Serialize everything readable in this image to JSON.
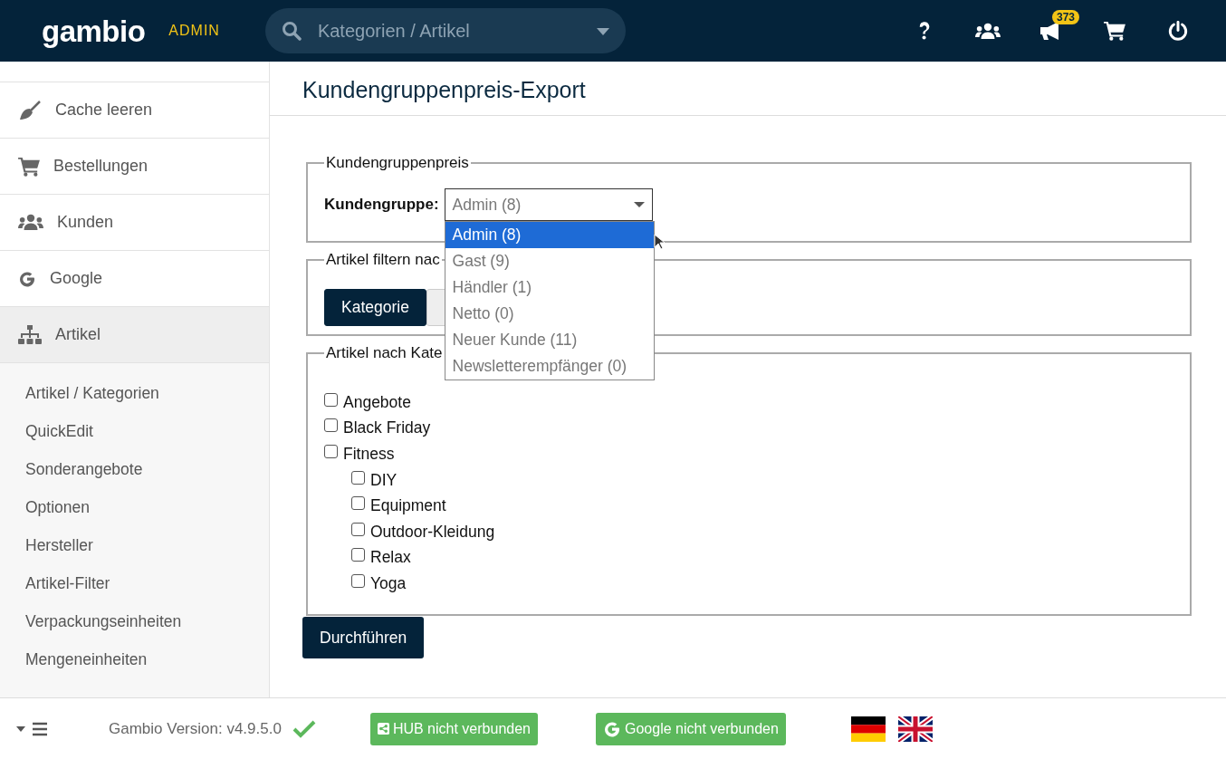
{
  "header": {
    "logo": "gambio",
    "tag": "ADMIN",
    "search": {
      "placeholder": "Kategorien / Artikel"
    },
    "icons": [
      {
        "kind": "help"
      },
      {
        "kind": "users"
      },
      {
        "kind": "bullhorn",
        "count": "373"
      },
      {
        "kind": "cart"
      },
      {
        "kind": "power"
      }
    ]
  },
  "sidebar": {
    "items": [
      {
        "label": "Cache leeren",
        "kind": "broom",
        "selected": false
      },
      {
        "label": "Bestellungen",
        "kind": "cart",
        "selected": false
      },
      {
        "label": "Kunden",
        "kind": "users",
        "selected": false
      },
      {
        "label": "Google",
        "kind": "google",
        "selected": false
      },
      {
        "label": "Artikel",
        "kind": "sitemap",
        "selected": true
      }
    ],
    "subitems": [
      "Artikel / Kategorien",
      "QuickEdit",
      "Sonderangebote",
      "Optionen",
      "Hersteller",
      "Artikel-Filter",
      "Verpackungseinheiten",
      "Mengeneinheiten"
    ]
  },
  "page": {
    "title": "Kundengruppenpreis-Export",
    "group_fieldset": {
      "legend": "Kundengruppenpreis",
      "label": "Kundengruppe:",
      "value": "Admin (8)",
      "expanded": true,
      "options": [
        {
          "label": "Admin (8)",
          "selected": true
        },
        {
          "label": "Gast (9)",
          "selected": false
        },
        {
          "label": "Händler (1)",
          "selected": false
        },
        {
          "label": "Netto (0)",
          "selected": false
        },
        {
          "label": "Neuer Kunde (11)",
          "selected": false
        },
        {
          "label": "Newsletterempfänger (0)",
          "selected": false
        }
      ]
    },
    "filter_fieldset": {
      "legend": "Artikel filtern nac",
      "buttons": [
        {
          "label": "Kategorie",
          "selected": true
        },
        {
          "selected": false
        }
      ]
    },
    "category_fieldset": {
      "legend": "Artikel nach Kate",
      "categories": [
        {
          "label": "Angebote",
          "checked": false
        },
        {
          "label": "Black Friday",
          "checked": false
        },
        {
          "label": "Fitness",
          "checked": false,
          "children": [
            {
              "label": "DIY",
              "checked": false
            },
            {
              "label": "Equipment",
              "checked": false
            },
            {
              "label": "Outdoor-Kleidung",
              "checked": false
            },
            {
              "label": "Relax",
              "checked": false
            },
            {
              "label": "Yoga",
              "checked": false
            }
          ]
        }
      ]
    },
    "submit": "Durchführen"
  },
  "footer": {
    "version": "Gambio Version: v4.9.5.0",
    "version_ok": true,
    "status_buttons": [
      {
        "kind": "hub",
        "label": "HUB nicht verbunden"
      },
      {
        "kind": "google",
        "label": "Google nicht verbunden"
      }
    ],
    "languages": [
      {
        "kind": "de",
        "selected": false
      },
      {
        "kind": "en",
        "selected": false
      }
    ]
  }
}
